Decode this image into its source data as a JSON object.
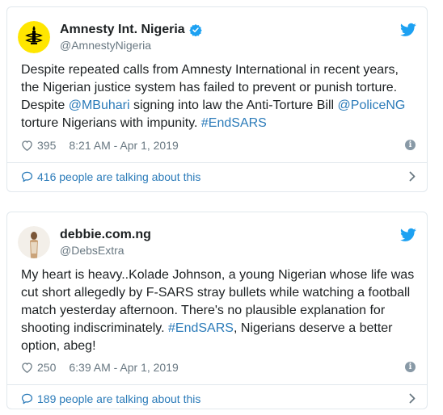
{
  "tweets": [
    {
      "name": "Amnesty Int. Nigeria",
      "handle": "@AmnestyNigeria",
      "verified": true,
      "text_parts": [
        {
          "t": "Despite repeated calls from Amnesty International in recent years, the Nigerian justice system has failed to prevent or punish torture. Despite ",
          "link": false
        },
        {
          "t": "@MBuhari",
          "link": true
        },
        {
          "t": " signing into law the Anti-Torture Bill ",
          "link": false
        },
        {
          "t": "@PoliceNG",
          "link": true
        },
        {
          "t": " torture Nigerians with impunity. ",
          "link": false
        },
        {
          "t": "#EndSARS",
          "link": true
        }
      ],
      "likes": "395",
      "timestamp": "8:21 AM - Apr 1, 2019",
      "talking": "416 people are talking about this"
    },
    {
      "name": "debbie.com.ng",
      "handle": "@DebsExtra",
      "verified": false,
      "text_parts": [
        {
          "t": "My heart is heavy..Kolade Johnson, a young Nigerian whose life was cut short allegedly by F-SARS stray bullets while watching a football match yesterday afternoon. There's no plausible explanation for shooting indiscriminately. ",
          "link": false
        },
        {
          "t": "#EndSARS",
          "link": true
        },
        {
          "t": ", Nigerians deserve a better option, abeg!",
          "link": false
        }
      ],
      "likes": "250",
      "timestamp": "6:39 AM - Apr 1, 2019",
      "talking": "189 people are talking about this"
    }
  ],
  "icons": {
    "bird": "twitter-bird-icon",
    "heart": "heart-icon",
    "info": "info-icon",
    "bubble": "speech-bubble-icon",
    "chevron": "chevron-right-icon",
    "verified": "verified-badge-icon"
  },
  "colors": {
    "link": "#2b7bb9",
    "twitter_blue": "#1da1f2",
    "muted": "#697882",
    "border": "#e1e8ed",
    "amnesty_yellow": "#ffe600"
  }
}
